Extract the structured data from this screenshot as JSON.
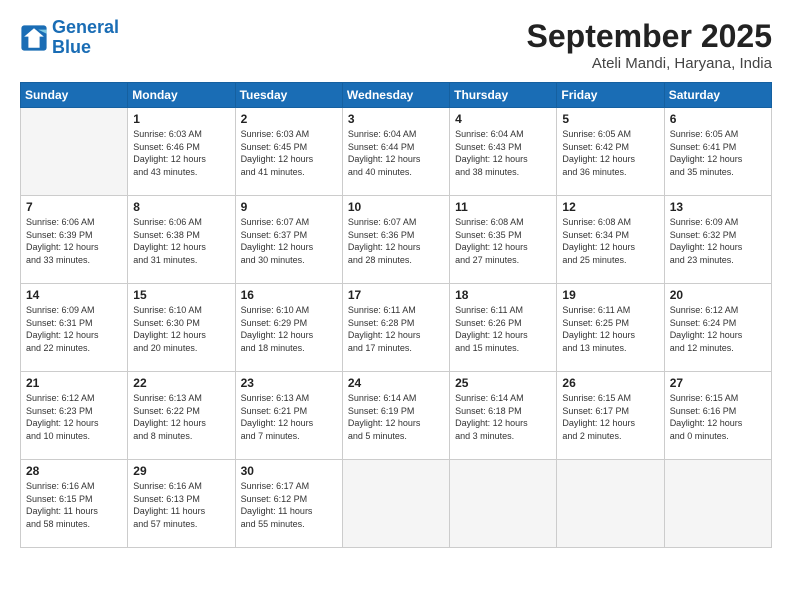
{
  "header": {
    "logo_line1": "General",
    "logo_line2": "Blue",
    "month_title": "September 2025",
    "location": "Ateli Mandi, Haryana, India"
  },
  "weekdays": [
    "Sunday",
    "Monday",
    "Tuesday",
    "Wednesday",
    "Thursday",
    "Friday",
    "Saturday"
  ],
  "weeks": [
    [
      {
        "day": "",
        "info": ""
      },
      {
        "day": "1",
        "info": "Sunrise: 6:03 AM\nSunset: 6:46 PM\nDaylight: 12 hours\nand 43 minutes."
      },
      {
        "day": "2",
        "info": "Sunrise: 6:03 AM\nSunset: 6:45 PM\nDaylight: 12 hours\nand 41 minutes."
      },
      {
        "day": "3",
        "info": "Sunrise: 6:04 AM\nSunset: 6:44 PM\nDaylight: 12 hours\nand 40 minutes."
      },
      {
        "day": "4",
        "info": "Sunrise: 6:04 AM\nSunset: 6:43 PM\nDaylight: 12 hours\nand 38 minutes."
      },
      {
        "day": "5",
        "info": "Sunrise: 6:05 AM\nSunset: 6:42 PM\nDaylight: 12 hours\nand 36 minutes."
      },
      {
        "day": "6",
        "info": "Sunrise: 6:05 AM\nSunset: 6:41 PM\nDaylight: 12 hours\nand 35 minutes."
      }
    ],
    [
      {
        "day": "7",
        "info": "Sunrise: 6:06 AM\nSunset: 6:39 PM\nDaylight: 12 hours\nand 33 minutes."
      },
      {
        "day": "8",
        "info": "Sunrise: 6:06 AM\nSunset: 6:38 PM\nDaylight: 12 hours\nand 31 minutes."
      },
      {
        "day": "9",
        "info": "Sunrise: 6:07 AM\nSunset: 6:37 PM\nDaylight: 12 hours\nand 30 minutes."
      },
      {
        "day": "10",
        "info": "Sunrise: 6:07 AM\nSunset: 6:36 PM\nDaylight: 12 hours\nand 28 minutes."
      },
      {
        "day": "11",
        "info": "Sunrise: 6:08 AM\nSunset: 6:35 PM\nDaylight: 12 hours\nand 27 minutes."
      },
      {
        "day": "12",
        "info": "Sunrise: 6:08 AM\nSunset: 6:34 PM\nDaylight: 12 hours\nand 25 minutes."
      },
      {
        "day": "13",
        "info": "Sunrise: 6:09 AM\nSunset: 6:32 PM\nDaylight: 12 hours\nand 23 minutes."
      }
    ],
    [
      {
        "day": "14",
        "info": "Sunrise: 6:09 AM\nSunset: 6:31 PM\nDaylight: 12 hours\nand 22 minutes."
      },
      {
        "day": "15",
        "info": "Sunrise: 6:10 AM\nSunset: 6:30 PM\nDaylight: 12 hours\nand 20 minutes."
      },
      {
        "day": "16",
        "info": "Sunrise: 6:10 AM\nSunset: 6:29 PM\nDaylight: 12 hours\nand 18 minutes."
      },
      {
        "day": "17",
        "info": "Sunrise: 6:11 AM\nSunset: 6:28 PM\nDaylight: 12 hours\nand 17 minutes."
      },
      {
        "day": "18",
        "info": "Sunrise: 6:11 AM\nSunset: 6:26 PM\nDaylight: 12 hours\nand 15 minutes."
      },
      {
        "day": "19",
        "info": "Sunrise: 6:11 AM\nSunset: 6:25 PM\nDaylight: 12 hours\nand 13 minutes."
      },
      {
        "day": "20",
        "info": "Sunrise: 6:12 AM\nSunset: 6:24 PM\nDaylight: 12 hours\nand 12 minutes."
      }
    ],
    [
      {
        "day": "21",
        "info": "Sunrise: 6:12 AM\nSunset: 6:23 PM\nDaylight: 12 hours\nand 10 minutes."
      },
      {
        "day": "22",
        "info": "Sunrise: 6:13 AM\nSunset: 6:22 PM\nDaylight: 12 hours\nand 8 minutes."
      },
      {
        "day": "23",
        "info": "Sunrise: 6:13 AM\nSunset: 6:21 PM\nDaylight: 12 hours\nand 7 minutes."
      },
      {
        "day": "24",
        "info": "Sunrise: 6:14 AM\nSunset: 6:19 PM\nDaylight: 12 hours\nand 5 minutes."
      },
      {
        "day": "25",
        "info": "Sunrise: 6:14 AM\nSunset: 6:18 PM\nDaylight: 12 hours\nand 3 minutes."
      },
      {
        "day": "26",
        "info": "Sunrise: 6:15 AM\nSunset: 6:17 PM\nDaylight: 12 hours\nand 2 minutes."
      },
      {
        "day": "27",
        "info": "Sunrise: 6:15 AM\nSunset: 6:16 PM\nDaylight: 12 hours\nand 0 minutes."
      }
    ],
    [
      {
        "day": "28",
        "info": "Sunrise: 6:16 AM\nSunset: 6:15 PM\nDaylight: 11 hours\nand 58 minutes."
      },
      {
        "day": "29",
        "info": "Sunrise: 6:16 AM\nSunset: 6:13 PM\nDaylight: 11 hours\nand 57 minutes."
      },
      {
        "day": "30",
        "info": "Sunrise: 6:17 AM\nSunset: 6:12 PM\nDaylight: 11 hours\nand 55 minutes."
      },
      {
        "day": "",
        "info": ""
      },
      {
        "day": "",
        "info": ""
      },
      {
        "day": "",
        "info": ""
      },
      {
        "day": "",
        "info": ""
      }
    ]
  ]
}
